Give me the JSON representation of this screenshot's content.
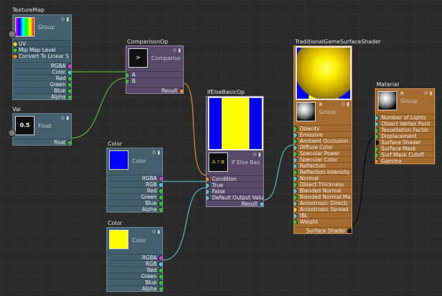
{
  "nodes": {
    "texturemap": {
      "title": "TextureMap",
      "kind": "Group",
      "inputs": [
        "UV",
        "Mip Map Level",
        "Convert To Linear S"
      ],
      "outputs": [
        "RGBA",
        "Color",
        "Red",
        "Green",
        "Blue",
        "Alpha"
      ]
    },
    "val": {
      "title": "Val",
      "value": "0.5",
      "kind": "Float",
      "outputs": [
        "float"
      ]
    },
    "comparison": {
      "title": "ComparisonOp",
      "symbol": ">",
      "kind": "Compariso",
      "inputs": [
        "A",
        "B"
      ],
      "outputs": [
        "Result"
      ]
    },
    "ifelse": {
      "title": "IfElseBasicOp",
      "symbol": "A ? B",
      "kind": "If Else Bas",
      "inputs": [
        "Condition",
        "True",
        "False",
        "Default Output Valu"
      ],
      "outputs": [
        "Result"
      ]
    },
    "color_blue": {
      "title": "Color",
      "kind": "Color",
      "swatch": "#0000ff",
      "outputs": [
        "RGBA",
        "RGB",
        "Red",
        "Green",
        "Blue",
        "Alpha"
      ]
    },
    "color_yellow": {
      "title": "Color",
      "kind": "Color",
      "swatch": "#ffff00",
      "outputs": [
        "RGBA",
        "RGB",
        "Red",
        "Green",
        "Blue",
        "Alpha"
      ]
    },
    "traditional": {
      "title": "TraditionalGameSurfaceShader",
      "kind": "Group",
      "badge": "R",
      "inputs": [
        "Opacity",
        "Emissive",
        "Ambient Occlusion",
        "Diffuse Color",
        "Specular Power",
        "Specular Color",
        "Reflection",
        "Reflection Intensity",
        "Normal",
        "Object Thickness",
        "Blended Normal",
        "Blended Normal Ma",
        "Anisotropic Directi",
        "Anisotropic Spread",
        "IBL",
        "Weight"
      ],
      "outputs": [
        "Surface Shader"
      ]
    },
    "material": {
      "title": "Material",
      "kind": "Group",
      "badge": "R",
      "inputs": [
        "Number of Lights",
        "Object Vertex Posit",
        "Tessellation Factor",
        "Displacement",
        "Surface Shader",
        "Surface Mask",
        "Surf Mask Cutoff",
        "Gamma"
      ]
    }
  },
  "colors": {
    "port_green": "#3bbf3b",
    "port_cyan": "#4fc6d6",
    "port_magenta": "#d43bd4",
    "port_orange": "#e88a2a",
    "port_yellow": "#f0d040",
    "wire_green": "#56b13a",
    "wire_cyan": "#4bb6c2",
    "wire_orange": "#d6892c",
    "wire_black": "#101010"
  }
}
